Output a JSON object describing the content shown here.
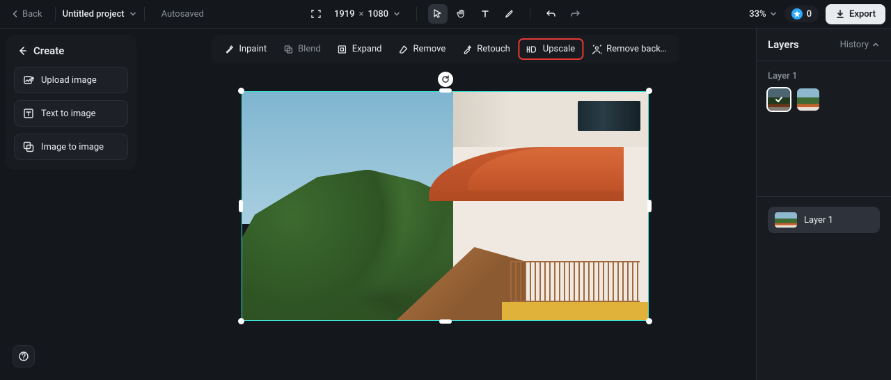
{
  "topbar": {
    "back": "Back",
    "project": "Untitled project",
    "status": "Autosaved",
    "width": "1919",
    "height": "1080",
    "zoom": "33%",
    "credits": "0",
    "export": "Export"
  },
  "left": {
    "create": "Create",
    "options": [
      "Upload image",
      "Text to image",
      "Image to image"
    ]
  },
  "toolbar": {
    "inpaint": "Inpaint",
    "blend": "Blend",
    "expand": "Expand",
    "remove": "Remove",
    "retouch": "Retouch",
    "upscale": "Upscale",
    "remove_bg": "Remove back…"
  },
  "right": {
    "layers": "Layers",
    "history": "History",
    "layer_section_label": "Layer 1",
    "layer_item_name": "Layer 1"
  }
}
